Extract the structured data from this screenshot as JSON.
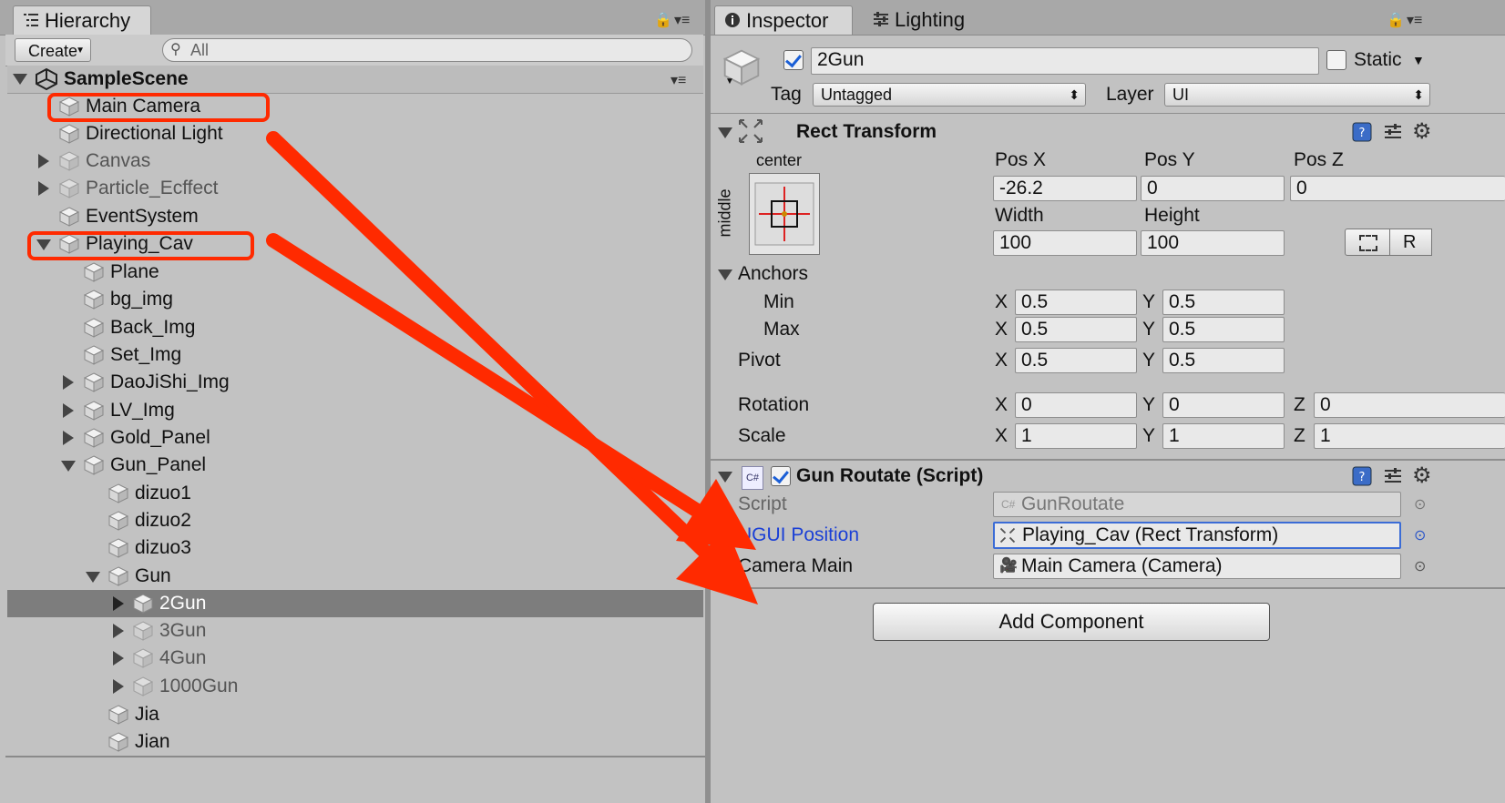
{
  "hierarchy": {
    "tab_label": "Hierarchy",
    "create_label": "Create",
    "search_placeholder": "All",
    "scene_name": "SampleScene",
    "items": [
      {
        "label": "Main Camera"
      },
      {
        "label": "Directional Light"
      },
      {
        "label": "Canvas"
      },
      {
        "label": "Particle_Ecffect"
      },
      {
        "label": "EventSystem"
      },
      {
        "label": "Playing_Cav"
      },
      {
        "label": "Plane"
      },
      {
        "label": "bg_img"
      },
      {
        "label": "Back_Img"
      },
      {
        "label": "Set_Img"
      },
      {
        "label": "DaoJiShi_Img"
      },
      {
        "label": "LV_Img"
      },
      {
        "label": "Gold_Panel"
      },
      {
        "label": "Gun_Panel"
      },
      {
        "label": "dizuo1"
      },
      {
        "label": "dizuo2"
      },
      {
        "label": "dizuo3"
      },
      {
        "label": "Gun"
      },
      {
        "label": "2Gun"
      },
      {
        "label": "3Gun"
      },
      {
        "label": "4Gun"
      },
      {
        "label": "1000Gun"
      },
      {
        "label": "Jia"
      },
      {
        "label": "Jian"
      }
    ]
  },
  "inspector": {
    "tab_label": "Inspector",
    "lighting_tab_label": "Lighting",
    "object_name": "2Gun",
    "static_label": "Static",
    "tag_label": "Tag",
    "tag_value": "Untagged",
    "layer_label": "Layer",
    "layer_value": "UI",
    "rect_transform": {
      "title": "Rect Transform",
      "anchor_h": "center",
      "anchor_v": "middle",
      "pos_x_label": "Pos X",
      "pos_y_label": "Pos Y",
      "pos_z_label": "Pos Z",
      "pos_x": "-26.2",
      "pos_y": "0",
      "pos_z": "0",
      "width_label": "Width",
      "height_label": "Height",
      "width": "100",
      "height": "100",
      "raw_button_label": "R",
      "anchors_label": "Anchors",
      "min_label": "Min",
      "max_label": "Max",
      "pivot_label": "Pivot",
      "x_label": "X",
      "y_label": "Y",
      "z_label": "Z",
      "min_x": "0.5",
      "min_y": "0.5",
      "max_x": "0.5",
      "max_y": "0.5",
      "pivot_x": "0.5",
      "pivot_y": "0.5",
      "rotation_label": "Rotation",
      "rot_x": "0",
      "rot_y": "0",
      "rot_z": "0",
      "scale_label": "Scale",
      "scale_x": "1",
      "scale_y": "1",
      "scale_z": "1"
    },
    "script_component": {
      "title": "Gun Routate (Script)",
      "script_label": "Script",
      "script_value": "GunRoutate",
      "ugui_label": "UGUI Position",
      "ugui_value": "Playing_Cav (Rect Transform)",
      "camera_label": "Camera Main",
      "camera_value": "Main Camera (Camera)"
    },
    "add_component_label": "Add Component"
  },
  "colors": {
    "annotation_red": "#ff2a00",
    "link_blue": "#1a3fd6",
    "selected_row": "#7d7d7d"
  }
}
